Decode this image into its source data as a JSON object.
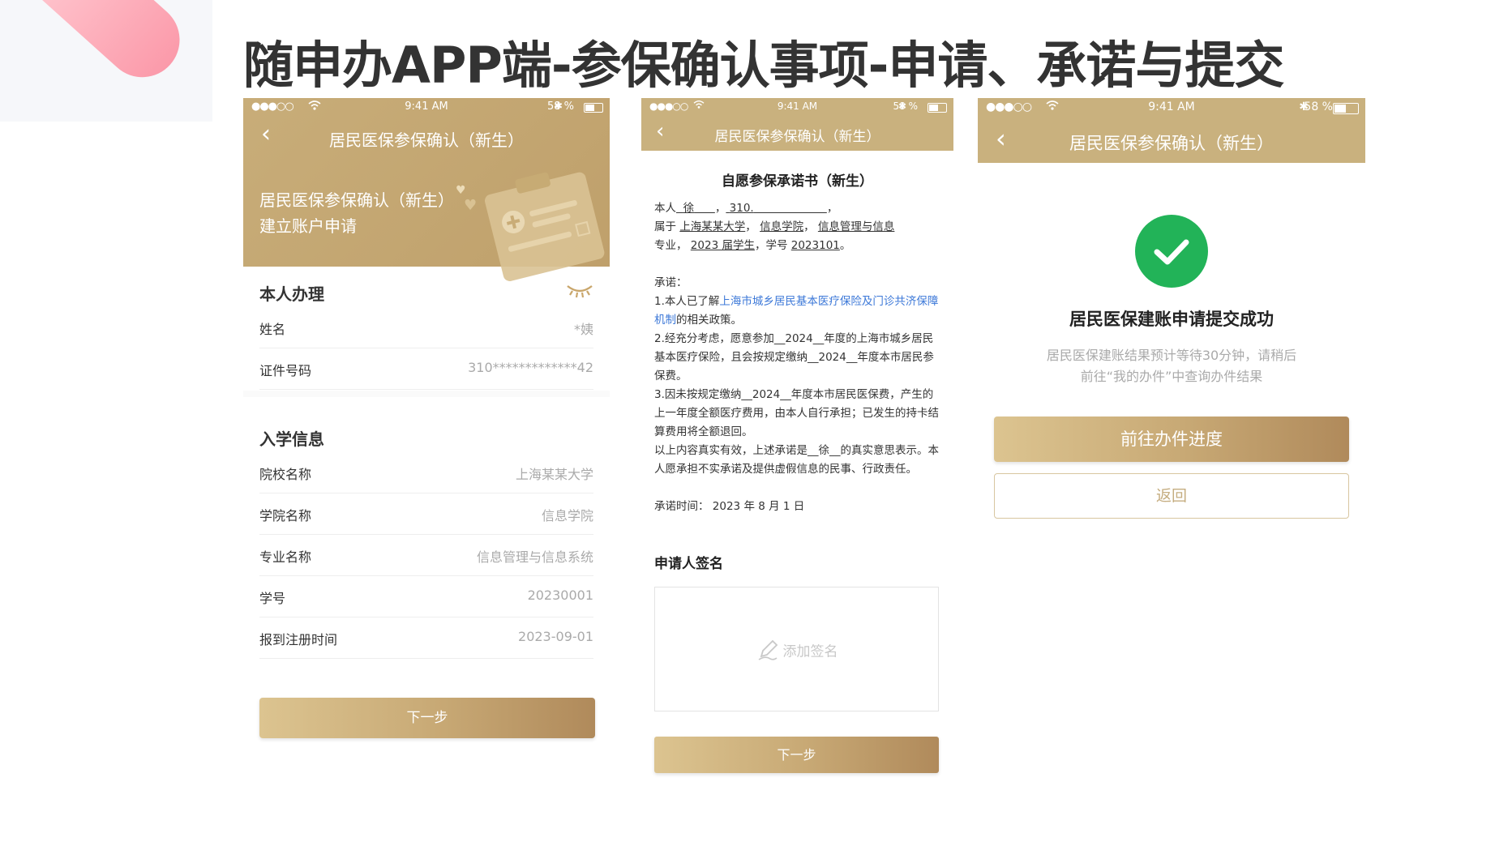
{
  "slide": {
    "title": "随申办APP端-参保确认事项-申请、承诺与提交"
  },
  "status_bar": {
    "signal": "●●●○○",
    "time": "9:41 AM",
    "bluetooth": "✱",
    "battery": "58 %"
  },
  "screen1": {
    "nav_title": "居民医保参保确认（新生）",
    "banner_line1": "居民医保参保确认（新生）",
    "banner_line2": "建立账户申请",
    "section_self": "本人办理",
    "rows_self": [
      {
        "key": "姓名",
        "value": "*姨"
      },
      {
        "key": "证件号码",
        "value": "310*************42"
      }
    ],
    "section_school": "入学信息",
    "rows_school": [
      {
        "key": "院校名称",
        "value": "上海某某大学"
      },
      {
        "key": "学院名称",
        "value": "信息学院"
      },
      {
        "key": "专业名称",
        "value": "信息管理与信息系统"
      },
      {
        "key": "学号",
        "value": "20230001"
      },
      {
        "key": "报到注册时间",
        "value": "2023-09-01"
      }
    ],
    "next_button": "下一步"
  },
  "screen2": {
    "nav_title": "居民医保参保确认（新生）",
    "doc_title": "自愿参保承诺书（新生）",
    "l1_a": "本人",
    "l1_name": "徐",
    "l1_b": "，",
    "l1_id": "310.",
    "l1_c": "，",
    "l2_a": "属于",
    "l2_school": "上海某某大学",
    "l2_b": "，",
    "l2_college": "信息学院",
    "l2_c": "，",
    "l2_major": "信息管理与信息",
    "l3_a": "专业，",
    "l3_year": "2023 届学生",
    "l3_b": "，学号",
    "l3_no": "2023101",
    "l3_c": "。",
    "promise_label": "承诺：",
    "p1_a": "1.本人已了解",
    "p1_link": "上海市城乡居民基本医疗保险及门诊共济保障机制",
    "p1_b": "的相关政策。",
    "p2": "2.经充分考虑，愿意参加__2024__年度的上海市城乡居民基本医疗保险，且会按规定缴纳__2024__年度本市居民参保费。",
    "p3": "3.因未按规定缴纳__2024__年度本市居民医保费，产生的上一年度全额医疗费用，由本人自行承担；已发生的持卡结算费用将全额退回。",
    "p4_a": "以上内容真实有效，上述承诺是",
    "p4_name": "__徐",
    "p4_b": "__的真实意思表示。本人愿承担不实承诺及提供虚假信息的民事、行政责任。",
    "date": "承诺时间：  2023 年 8 月 1 日",
    "sign_label": "申请人签名",
    "sign_placeholder": "添加签名",
    "next_button": "下一步"
  },
  "screen3": {
    "nav_title": "居民医保参保确认（新生）",
    "success_title": "居民医保建账申请提交成功",
    "success_desc_1": "居民医保建账结果预计等待30分钟，请稍后",
    "success_desc_2": "前往“我的办件”中查询办件结果",
    "progress_button": "前往办件进度",
    "back_button": "返回"
  },
  "colors": {
    "gold": "#c9b17e",
    "success_green": "#22b358",
    "link_blue": "#3c78d8"
  }
}
